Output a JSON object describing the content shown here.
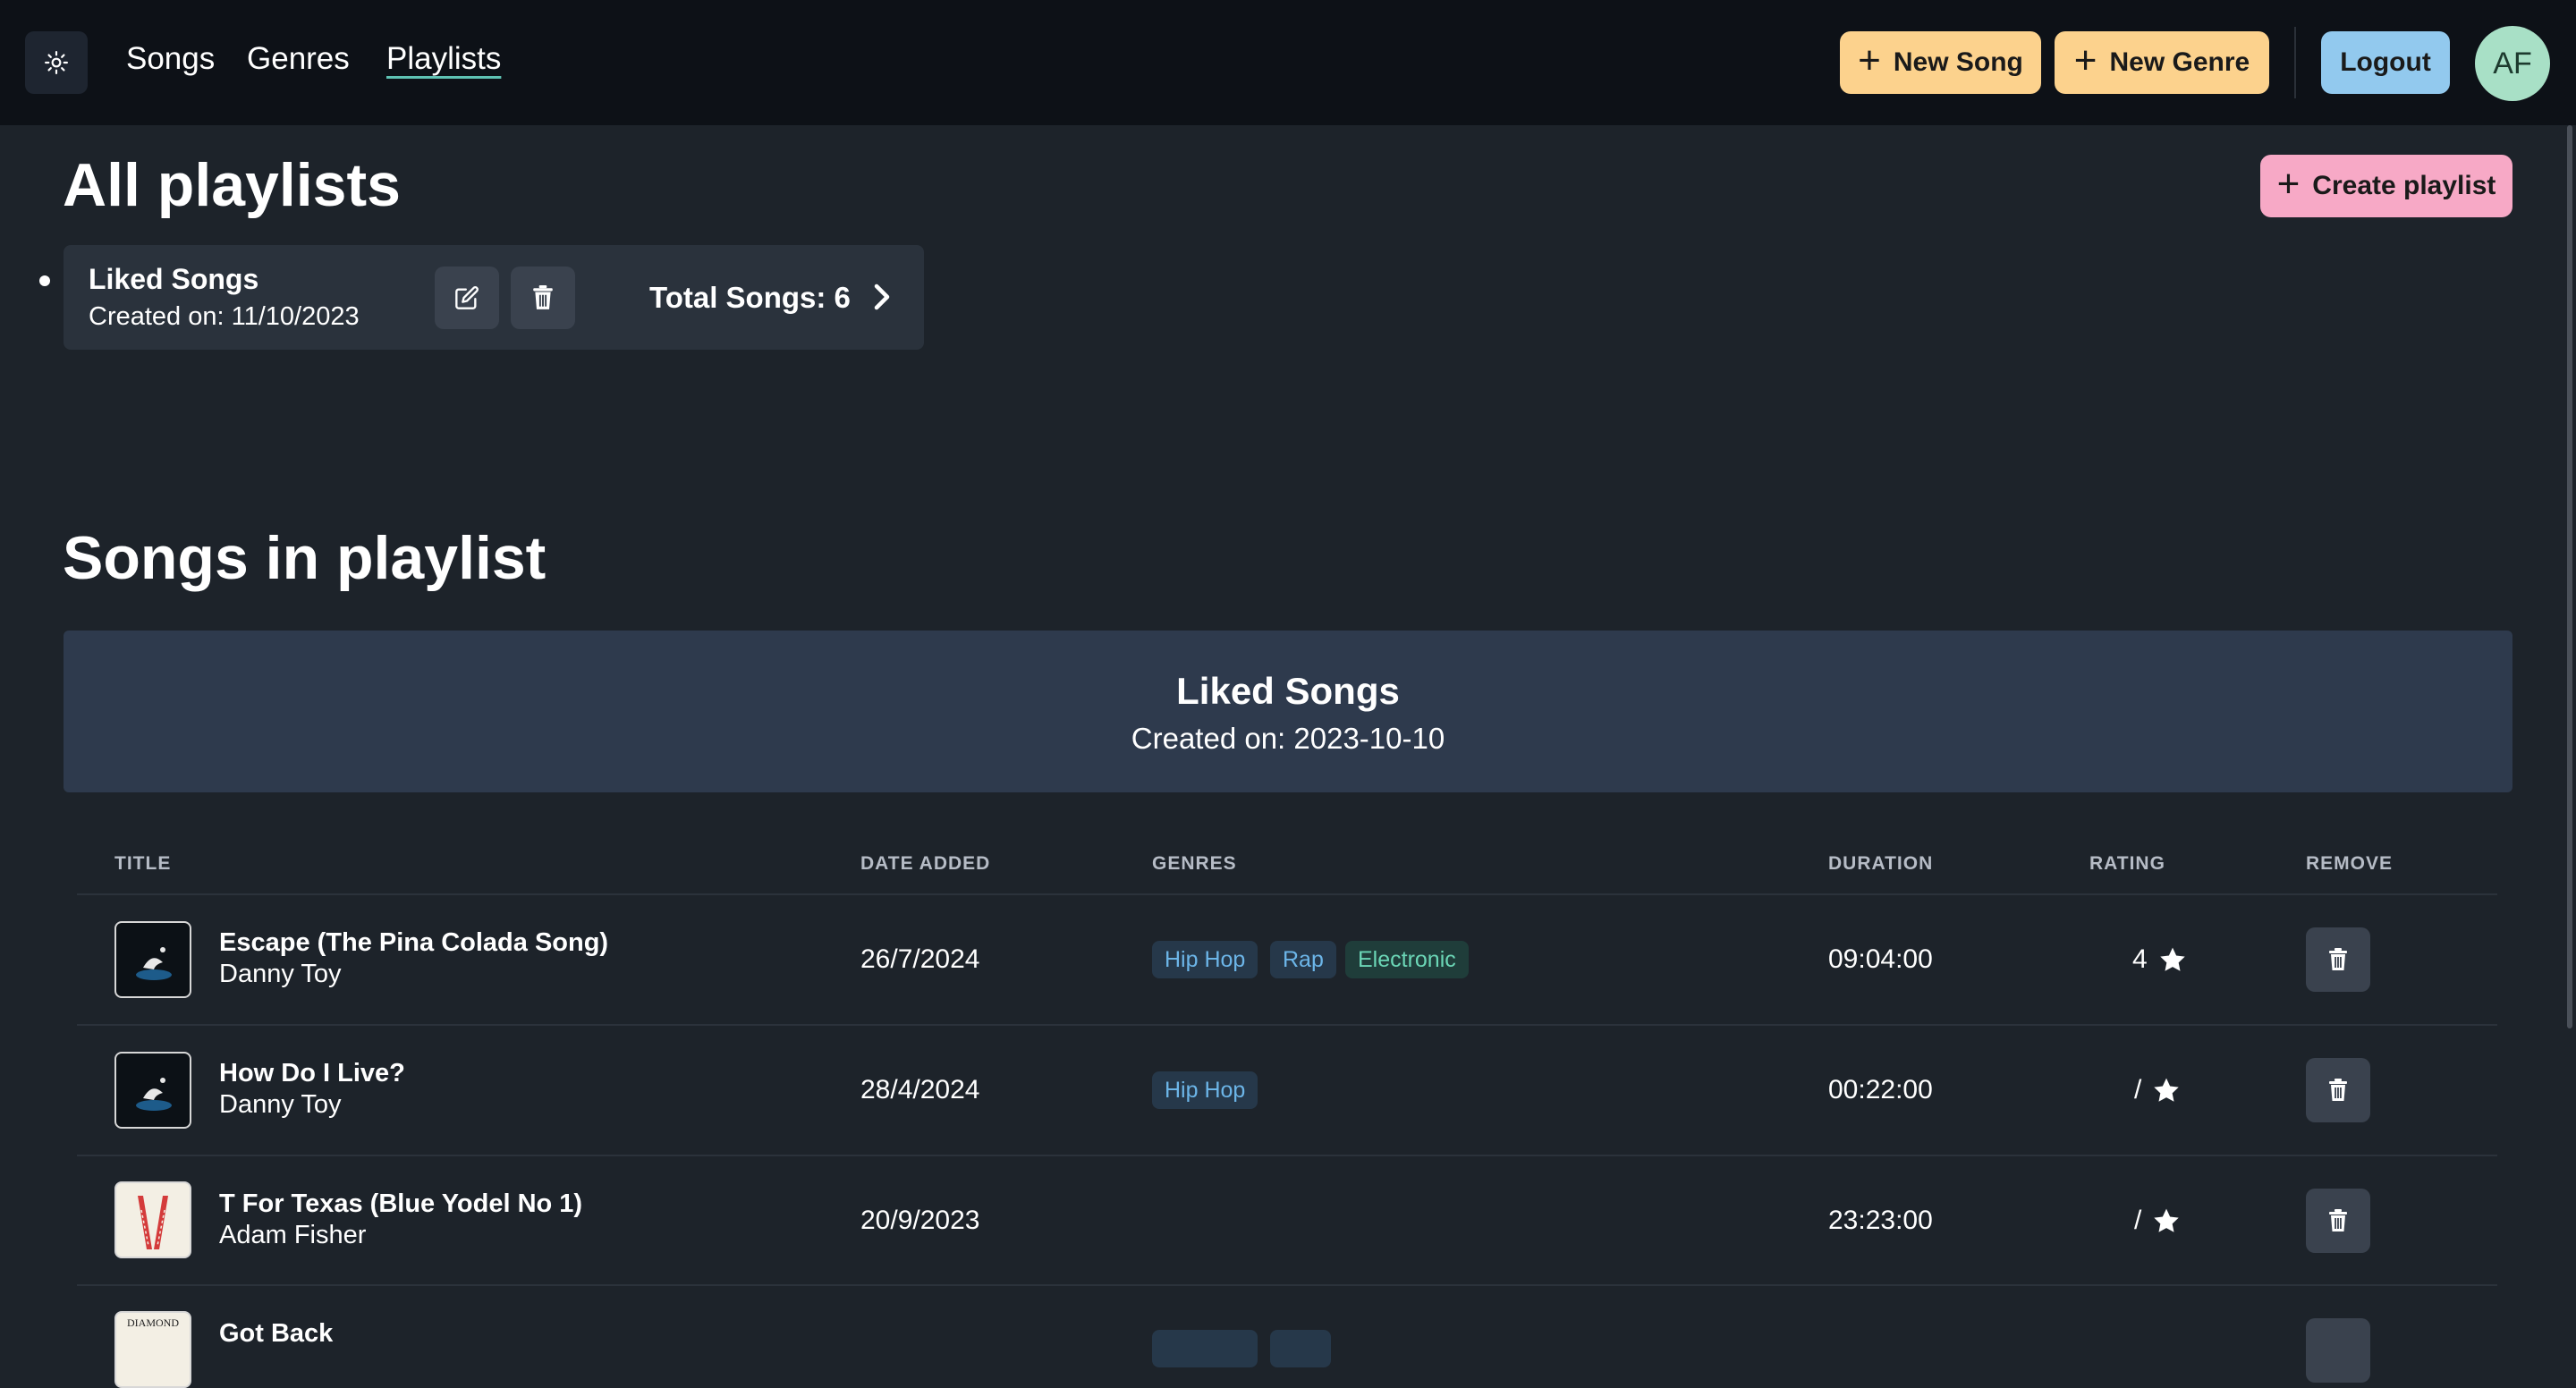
{
  "nav": {
    "links": [
      "Songs",
      "Genres",
      "Playlists"
    ],
    "new_song": "New Song",
    "new_genre": "New Genre",
    "logout": "Logout",
    "avatar_initials": "AF"
  },
  "playlists_section": {
    "title": "All playlists",
    "create_button": "Create playlist",
    "items": [
      {
        "name": "Liked Songs",
        "created": "Created on: 11/10/2023",
        "total": "Total Songs: 6"
      }
    ]
  },
  "songs_section": {
    "title": "Songs in playlist",
    "playlist_name": "Liked Songs",
    "playlist_created": "Created on: 2023-10-10",
    "columns": [
      "TITLE",
      "DATE ADDED",
      "GENRES",
      "DURATION",
      "RATING",
      "REMOVE"
    ],
    "rows": [
      {
        "title": "Escape (The Pina Colada Song)",
        "artist": "Danny Toy",
        "date_added": "26/7/2024",
        "genres": [
          "Hip Hop",
          "Rap",
          "Electronic"
        ],
        "duration": "09:04:00",
        "rating": "4"
      },
      {
        "title": "How Do I Live?",
        "artist": "Danny Toy",
        "date_added": "28/4/2024",
        "genres": [
          "Hip Hop"
        ],
        "duration": "00:22:00",
        "rating": "/"
      },
      {
        "title": "T For Texas (Blue Yodel No 1)",
        "artist": "Adam Fisher",
        "date_added": "20/9/2023",
        "genres": [],
        "duration": "23:23:00",
        "rating": "/"
      },
      {
        "title": "Got Back",
        "artist": "",
        "date_added": "",
        "genres": [],
        "duration": "",
        "rating": "",
        "thumb_text": "DIAMOND"
      }
    ]
  },
  "colors": {
    "navbar": "#0d1117",
    "background": "#1d232a",
    "yellow_button": "#fcd28d",
    "blue_button": "#92c9ee",
    "pink_button": "#f7a9c6",
    "badge_blue_text": "#6cb5e8",
    "badge_green_text": "#6bd6b6"
  },
  "icons": [
    "sun-icon",
    "plus-icon",
    "edit-icon",
    "trash-icon",
    "chevron-right-icon",
    "star-icon"
  ]
}
